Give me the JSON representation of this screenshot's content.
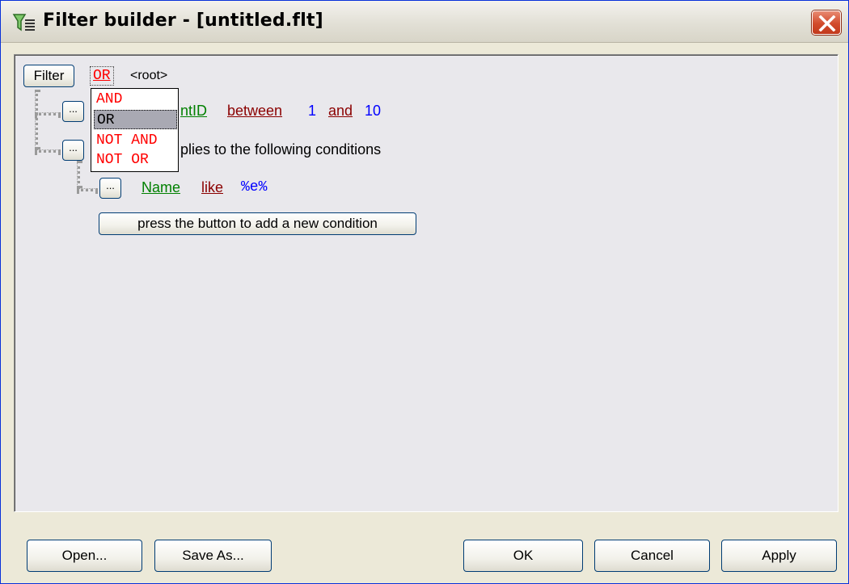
{
  "window": {
    "title": "Filter builder - [untitled.flt]"
  },
  "toolbar": {
    "filter_label": "Filter",
    "root_operator": "OR",
    "root_label": "<root>"
  },
  "conditions": [
    {
      "field": "ntID",
      "operator": "between",
      "value1": "1",
      "joiner": "and",
      "value2": "10"
    },
    {
      "text": "plies to the following conditions"
    },
    {
      "field": "Name",
      "operator": "like",
      "value1": "%e%"
    }
  ],
  "dots_label": "...",
  "add_condition_label": "press the button to add a new condition",
  "operator_menu": {
    "items": [
      "AND",
      "OR",
      "NOT AND",
      "NOT OR"
    ],
    "selected": "OR"
  },
  "buttons": {
    "open": "Open...",
    "save_as": "Save As...",
    "ok": "OK",
    "cancel": "Cancel",
    "apply": "Apply"
  },
  "colors": {
    "operator_red": "#ff0000",
    "field_green": "#008000",
    "op_darkred": "#8b0000",
    "value_blue": "#0000ff"
  }
}
